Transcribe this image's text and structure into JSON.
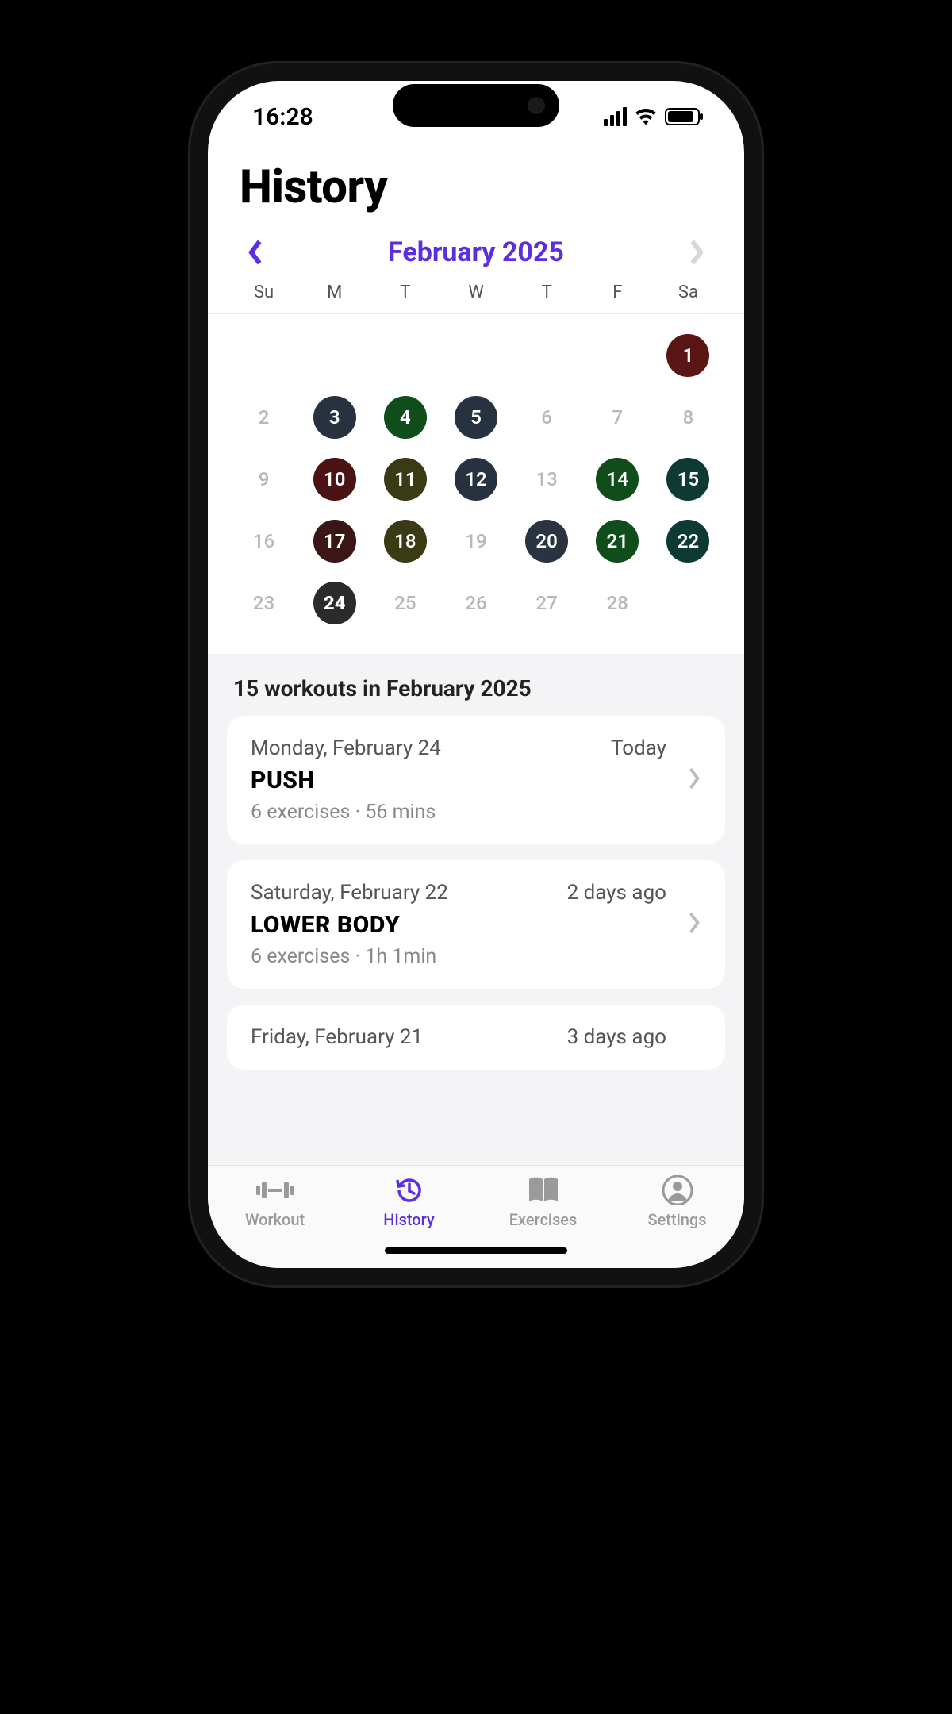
{
  "status": {
    "time": "16:28"
  },
  "page": {
    "title": "History"
  },
  "calendar": {
    "month_label": "February 2025",
    "weekdays": [
      "Su",
      "M",
      "T",
      "W",
      "T",
      "F",
      "Sa"
    ],
    "leading_blanks": 6,
    "days": [
      {
        "n": 1,
        "filled": true,
        "color": "#5a1515"
      },
      {
        "n": 2,
        "filled": false
      },
      {
        "n": 3,
        "filled": true,
        "color": "#26323f"
      },
      {
        "n": 4,
        "filled": true,
        "color": "#0f4d1a"
      },
      {
        "n": 5,
        "filled": true,
        "color": "#26323f"
      },
      {
        "n": 6,
        "filled": false
      },
      {
        "n": 7,
        "filled": false
      },
      {
        "n": 8,
        "filled": false
      },
      {
        "n": 9,
        "filled": false
      },
      {
        "n": 10,
        "filled": true,
        "color": "#4a1414"
      },
      {
        "n": 11,
        "filled": true,
        "color": "#3a3a14"
      },
      {
        "n": 12,
        "filled": true,
        "color": "#26323f"
      },
      {
        "n": 13,
        "filled": false
      },
      {
        "n": 14,
        "filled": true,
        "color": "#0f4d1a"
      },
      {
        "n": 15,
        "filled": true,
        "color": "#0d3a34"
      },
      {
        "n": 16,
        "filled": false
      },
      {
        "n": 17,
        "filled": true,
        "color": "#3a1616"
      },
      {
        "n": 18,
        "filled": true,
        "color": "#3a3a14"
      },
      {
        "n": 19,
        "filled": false
      },
      {
        "n": 20,
        "filled": true,
        "color": "#2a3340"
      },
      {
        "n": 21,
        "filled": true,
        "color": "#0f4d1a"
      },
      {
        "n": 22,
        "filled": true,
        "color": "#0d3a34"
      },
      {
        "n": 23,
        "filled": false
      },
      {
        "n": 24,
        "filled": true,
        "color": "#2b2b2b",
        "today": true
      },
      {
        "n": 25,
        "filled": false
      },
      {
        "n": 26,
        "filled": false
      },
      {
        "n": 27,
        "filled": false
      },
      {
        "n": 28,
        "filled": false
      }
    ]
  },
  "list": {
    "heading": "15 workouts in February 2025",
    "items": [
      {
        "date": "Monday, February 24",
        "relative": "Today",
        "title": "PUSH",
        "meta": "6 exercises · 56 mins"
      },
      {
        "date": "Saturday, February 22",
        "relative": "2 days ago",
        "title": "LOWER BODY",
        "meta": "6 exercises · 1h 1min"
      },
      {
        "date": "Friday, February 21",
        "relative": "3 days ago",
        "title": "",
        "meta": "",
        "partial": true
      }
    ]
  },
  "tabs": [
    {
      "label": "Workout",
      "icon": "dumbbell",
      "active": false
    },
    {
      "label": "History",
      "icon": "history",
      "active": true
    },
    {
      "label": "Exercises",
      "icon": "book",
      "active": false
    },
    {
      "label": "Settings",
      "icon": "person",
      "active": false
    }
  ]
}
